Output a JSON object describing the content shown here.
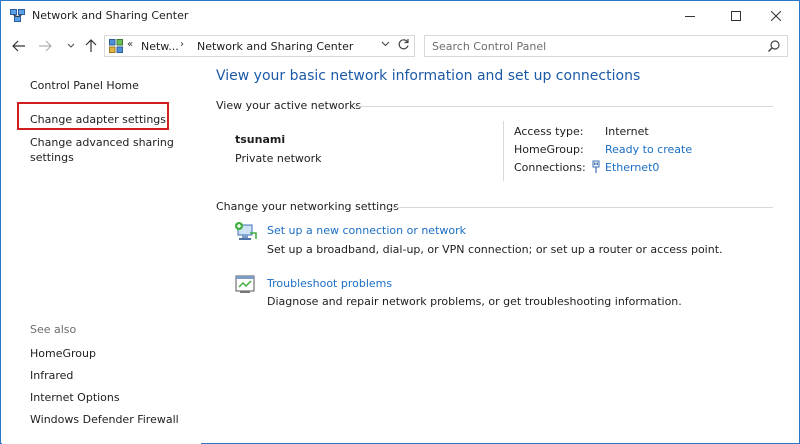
{
  "window": {
    "title": "Network and Sharing Center",
    "icon": "network-center-icon"
  },
  "address": {
    "chevron": "«",
    "crumb_1": "Netw...",
    "separator": "›",
    "crumb_2": "Network and Sharing Center"
  },
  "search": {
    "placeholder": "Search Control Panel"
  },
  "left_pane": {
    "home": "Control Panel Home",
    "adapter": "Change adapter settings",
    "advanced": "Change advanced sharing settings",
    "see_also_label": "See also",
    "see_also": [
      "HomeGroup",
      "Infrared",
      "Internet Options",
      "Windows Defender Firewall"
    ]
  },
  "main": {
    "title": "View your basic network information and set up connections",
    "active_networks_heading": "View your active networks",
    "network": {
      "name": "tsunami",
      "type": "Private network",
      "access_type_label": "Access type:",
      "access_type_value": "Internet",
      "homegroup_label": "HomeGroup:",
      "homegroup_value": "Ready to create",
      "connections_label": "Connections:",
      "connections_value": "Ethernet0"
    },
    "change_settings_heading": "Change your networking settings",
    "tasks": [
      {
        "icon": "new-connection-icon",
        "link": "Set up a new connection or network",
        "description": "Set up a broadband, dial-up, or VPN connection; or set up a router or access point."
      },
      {
        "icon": "troubleshoot-icon",
        "link": "Troubleshoot problems",
        "description": "Diagnose and repair network problems, or get troubleshooting information."
      }
    ]
  },
  "colors": {
    "link": "#1c6ec4",
    "title_blue": "#1c5aa6",
    "highlight_red": "#d11f1f",
    "window_border": "#2b78c9"
  }
}
